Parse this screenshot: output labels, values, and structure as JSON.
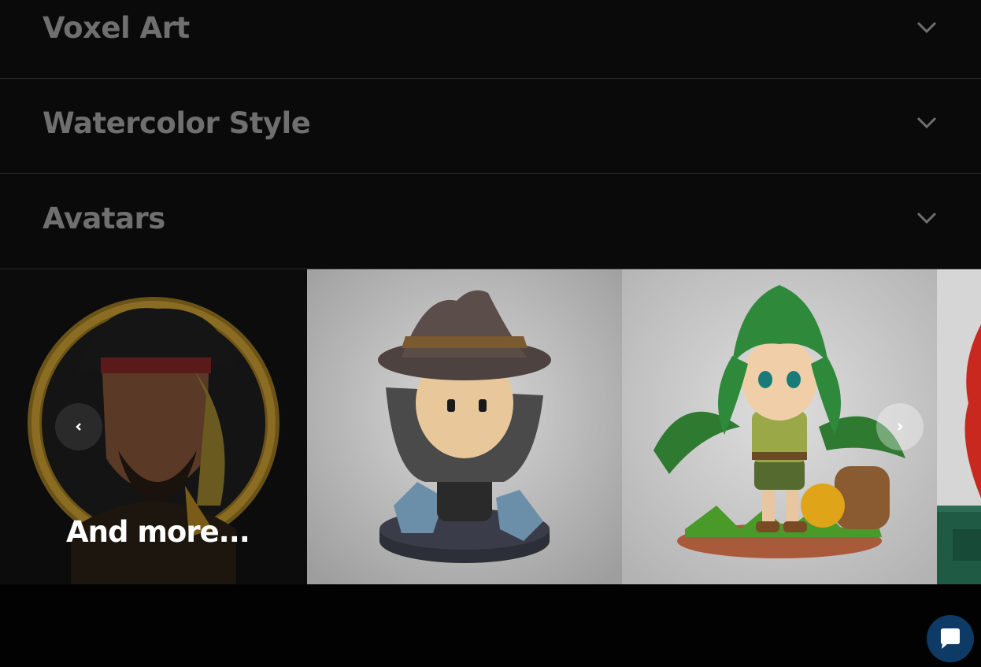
{
  "accordion": {
    "items": [
      {
        "label": "Voxel Art",
        "icon": "chevron-down-icon"
      },
      {
        "label": "Watercolor Style",
        "icon": "chevron-down-icon"
      },
      {
        "label": "Avatars",
        "icon": "chevron-down-icon"
      }
    ]
  },
  "carousel": {
    "more_label": "And more...",
    "slides": [
      {
        "subject": "pirate-avatar"
      },
      {
        "subject": "wizard-figurine"
      },
      {
        "subject": "jungle-explorer-figurine"
      },
      {
        "subject": "red-character-figurine"
      }
    ],
    "prev_icon": "chevron-left-icon",
    "next_icon": "chevron-right-icon"
  },
  "chat": {
    "icon": "chat-bubble-icon"
  },
  "colors": {
    "background": "#020202",
    "accordion_bg": "#0a0a0b",
    "accordion_text": "#6f6f6f",
    "chat_button": "#0d3b66"
  }
}
